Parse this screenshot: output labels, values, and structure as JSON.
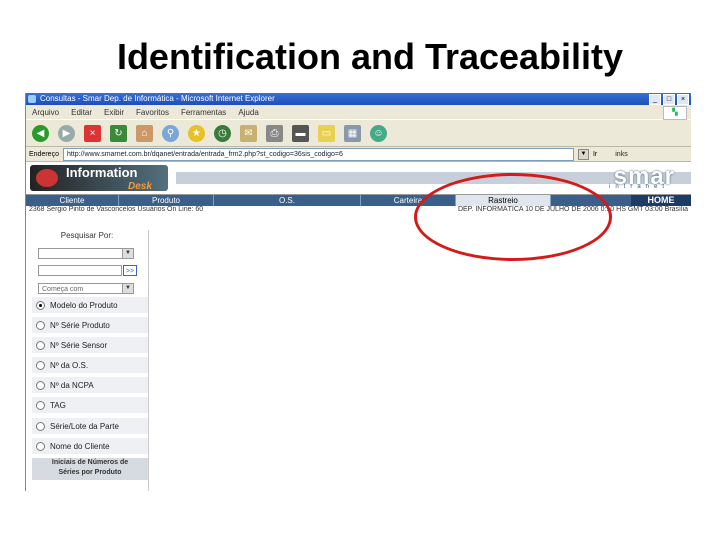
{
  "slide": {
    "title": "Identification and Traceability"
  },
  "window": {
    "title": "Consultas - Smar Dep. de Informática - Microsoft Internet Explorer",
    "controls": [
      "_",
      "□",
      "×"
    ]
  },
  "menu": [
    "Arquivo",
    "Editar",
    "Exibir",
    "Favoritos",
    "Ferramentas",
    "Ajuda"
  ],
  "address": {
    "label": "Endereço",
    "url": "http://www.smarnet.com.br/dqanet/entrada/entrada_frm2.php?st_codigo=36sis_codigo=6",
    "go": "Ir",
    "links": "inks"
  },
  "site": {
    "logo_text": "Information",
    "logo_sub": "Desk",
    "brand": "smar",
    "brand_sub": "intranet"
  },
  "nav": {
    "tabs": [
      "Cliente",
      "Produto",
      "O.S.",
      "Carteira",
      "Rastreio"
    ],
    "home": "HOME"
  },
  "status": {
    "user": "2368 Sergio Pinto de Vasconcelos   Usuários On Line: 60",
    "info": "DEP. INFORMÁTICA  10 DE JULHO DE 2006 0:10 HS GMT 03:00 Brasília"
  },
  "panel": {
    "title": "Pesquisar Por:",
    "select3": "Começa com",
    "arrow": ">>",
    "options": [
      {
        "label": "Modelo do Produto",
        "selected": true
      },
      {
        "label": "Nº Série Produto",
        "selected": false
      },
      {
        "label": "Nº Série Sensor",
        "selected": false
      },
      {
        "label": "Nº da O.S.",
        "selected": false
      },
      {
        "label": "Nº da NCPA",
        "selected": false
      },
      {
        "label": "TAG",
        "selected": false
      },
      {
        "label": "Série/Lote da Parte",
        "selected": false
      },
      {
        "label": "Nome do Cliente",
        "selected": false
      }
    ],
    "footer_line1": "Iniciais de Números de",
    "footer_line2": "Séries por Produto"
  },
  "colors": {
    "annotation": "#d51a1a",
    "nav": "#3a5f8a",
    "titlebar": "#1c4fb8"
  }
}
